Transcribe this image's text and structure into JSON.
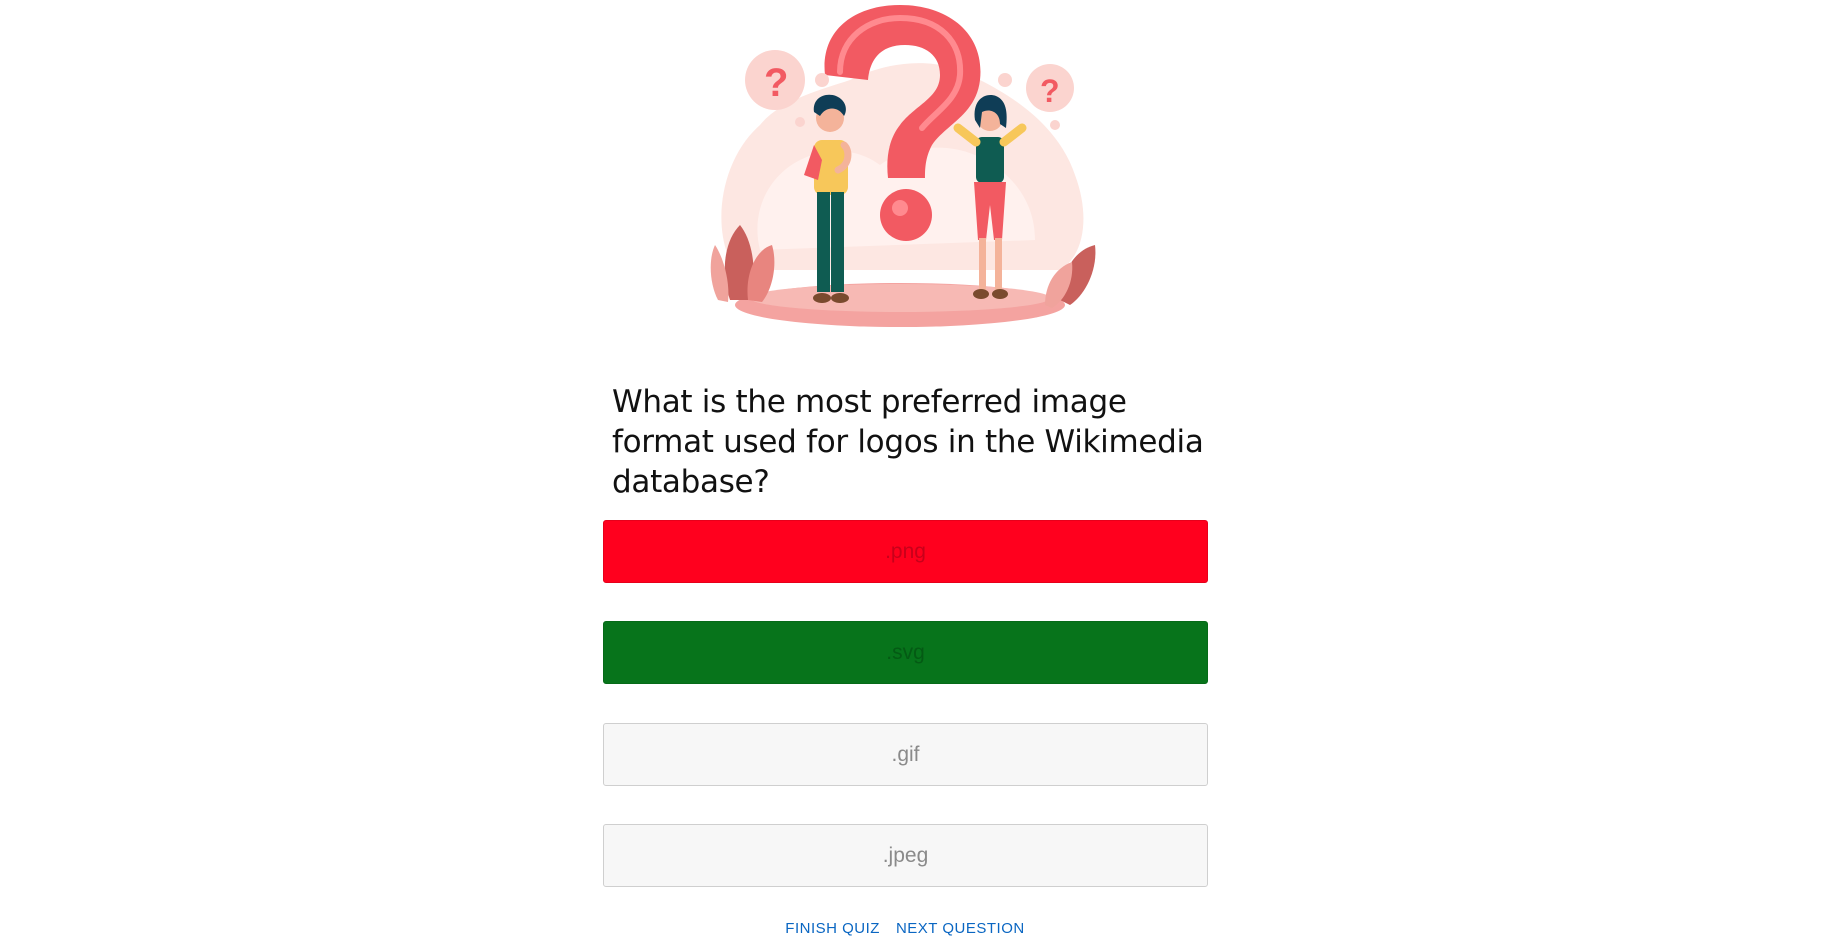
{
  "question": {
    "text": "What is the most preferred image format used for logos in the Wikimedia database?"
  },
  "answers": [
    {
      "label": ".png",
      "state": "wrong"
    },
    {
      "label": ".svg",
      "state": "correct"
    },
    {
      "label": ".gif",
      "state": "neutral"
    },
    {
      "label": ".jpeg",
      "state": "neutral"
    }
  ],
  "actions": {
    "finish_label": "FINISH QUIZ",
    "next_label": "NEXT QUESTION"
  },
  "illustration": {
    "icon": "question-mark-people-illustration",
    "colors": {
      "accent": "#f25a62",
      "teal": "#0f5c52",
      "yellow": "#f7c75a",
      "blush": "#fde2dc"
    }
  },
  "colors": {
    "wrong": "#ff001e",
    "correct": "#07741b",
    "neutral": "#f7f7f7",
    "link": "#0a66c2"
  }
}
